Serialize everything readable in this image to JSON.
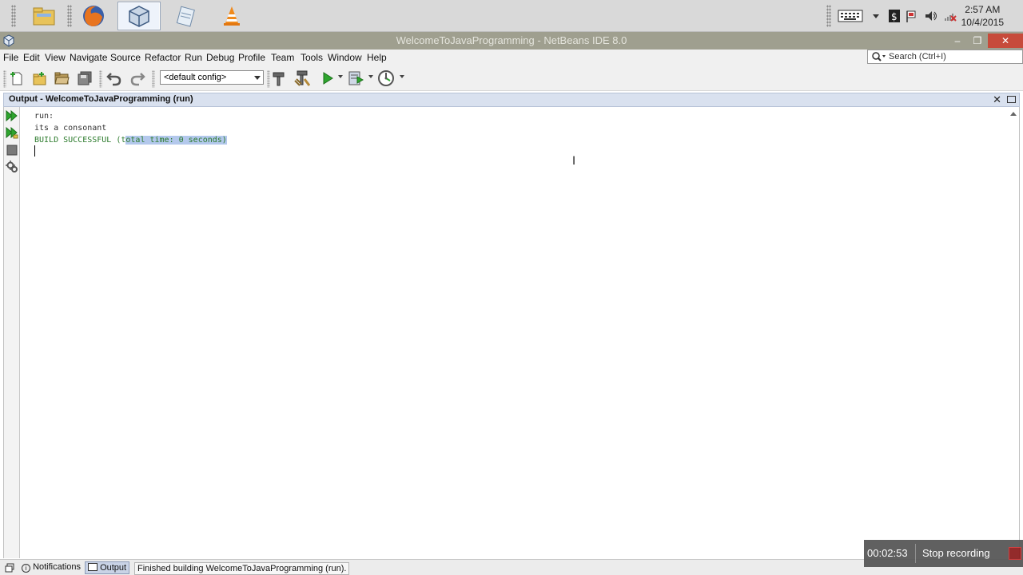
{
  "taskbar": {
    "apps": [
      {
        "name": "file-explorer",
        "active": false
      },
      {
        "name": "firefox",
        "active": false
      },
      {
        "name": "netbeans",
        "active": true
      },
      {
        "name": "notepad",
        "active": false
      },
      {
        "name": "vlc",
        "active": false
      }
    ],
    "clock": {
      "time": "2:57 AM",
      "date": "10/4/2015"
    }
  },
  "window": {
    "title": "WelcomeToJavaProgramming - NetBeans IDE 8.0"
  },
  "menu": {
    "items": [
      "File",
      "Edit",
      "View",
      "Navigate",
      "Source",
      "Refactor",
      "Run",
      "Debug",
      "Profile",
      "Team",
      "Tools",
      "Window",
      "Help"
    ]
  },
  "search": {
    "placeholder": "Search (Ctrl+I)"
  },
  "toolbar": {
    "config": "<default config>"
  },
  "output": {
    "title": "Output - WelcomeToJavaProgramming (run)",
    "lines": {
      "run": "run:",
      "result": "its a consonant",
      "build_prefix": "BUILD SUCCESSFUL (t",
      "build_selected": "otal time: 0 seconds)"
    }
  },
  "statusbar": {
    "notifications": "Notifications",
    "output": "Output",
    "message": "Finished building WelcomeToJavaProgramming (run)."
  },
  "recorder": {
    "elapsed": "00:02:53",
    "stop_label": "Stop recording"
  },
  "colors": {
    "titlebar": "#9f9f8f",
    "panel_header": "#d9e1ef",
    "build_success": "#2b7a2b",
    "selection": "#b3c8ec"
  }
}
